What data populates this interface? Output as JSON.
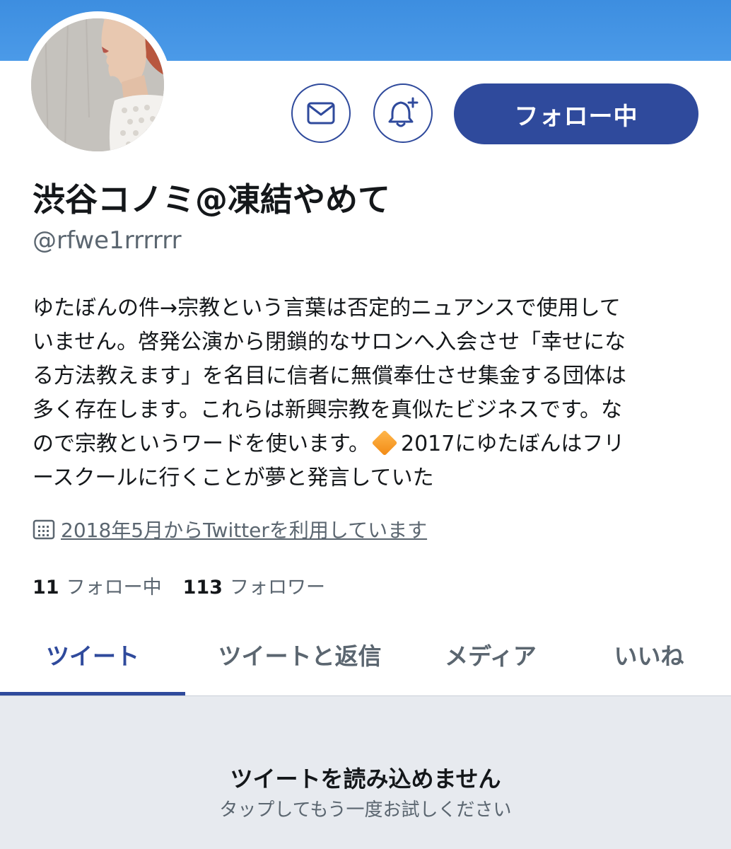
{
  "profile": {
    "display_name": "渋谷コノミ@凍結やめて",
    "handle": "@rfwe1rrrrrr",
    "bio_lines": [
      "ゆたぼんの件→宗教という言葉は否定的ニュアンスで使用して",
      "いません。啓発公演から閉鎖的なサロンへ入会させ「幸せにな",
      "る方法教えます」を名目に信者に無償奉仕させ集金する団体は",
      "多く存在します。これらは新興宗教を真似たビジネスです。な",
      "ので宗教というワードを使います。",
      "2017にゆたぼんはフリ",
      "ースクールに行くことが夢と発言していた"
    ],
    "joined": "2018年5月からTwitterを利用しています",
    "following_count": "11",
    "following_label": "フォロー中",
    "followers_count": "113",
    "followers_label": "フォロワー"
  },
  "actions": {
    "message_icon": "mail-icon",
    "notify_icon": "bell-plus-icon",
    "follow_label": "フォロー中"
  },
  "tabs": [
    {
      "label": "ツイート",
      "active": true
    },
    {
      "label": "ツイートと返信",
      "active": false
    },
    {
      "label": "メディア",
      "active": false
    },
    {
      "label": "いいね",
      "active": false
    }
  ],
  "error": {
    "title": "ツイートを読み込めません",
    "subtitle": "タップしてもう一度お試しください"
  },
  "colors": {
    "banner": "#4b9ae8",
    "accent": "#2f4a9c",
    "secondary_text": "#5b6670",
    "error_background": "#e7eaef"
  }
}
